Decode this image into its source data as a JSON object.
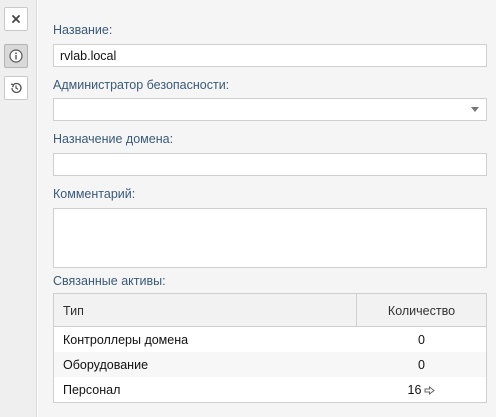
{
  "toolbar": {
    "close_icon": "close-icon",
    "info_icon": "info-icon",
    "history_icon": "history-icon"
  },
  "form": {
    "name_label": "Название:",
    "name_value": "rvlab.local",
    "security_admin_label": "Администратор безопасности:",
    "security_admin_value": "",
    "domain_purpose_label": "Назначение домена:",
    "domain_purpose_value": "",
    "comment_label": "Комментарий:",
    "comment_value": ""
  },
  "assets": {
    "label": "Связанные активы:",
    "columns": [
      "Тип",
      "Количество"
    ],
    "rows": [
      {
        "type": "Контроллеры домена",
        "count": "0"
      },
      {
        "type": "Оборудование",
        "count": "0"
      },
      {
        "type": "Персонал",
        "count": "16"
      }
    ]
  },
  "colors": {
    "label": "#3a5a78",
    "rail_bg": "#efefef",
    "content_bg": "#f5f5f5"
  }
}
